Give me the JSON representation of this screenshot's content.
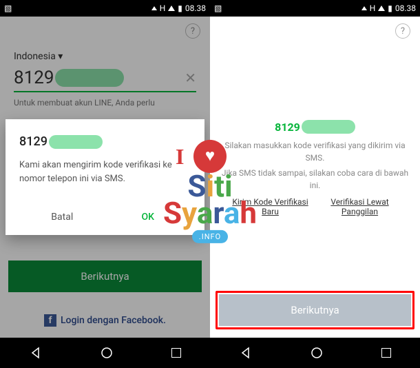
{
  "statusbar": {
    "time": "08.38",
    "net": "H"
  },
  "left": {
    "country": "Indonesia",
    "phone_prefix": "8129",
    "hint": "Untuk membuat akun LINE, Anda perlu",
    "primary": "Berikutnya",
    "fb": "Login dengan Facebook.",
    "dialog": {
      "phone_prefix": "8129",
      "msg": "Kami akan mengirim kode verifikasi ke nomor telepon ini via SMS.",
      "cancel": "Batal",
      "ok": "OK"
    }
  },
  "right": {
    "phone_prefix": "8129",
    "msg1": "Silakan masukkan kode verifikasi yang dikirim via SMS.",
    "msg2": "Jika SMS tidak sampai, silakan coba cara di bawah ini.",
    "link1": "Kirim Kode Verifikasi Baru",
    "link2": "Verifikasi Lewat Panggilan",
    "primary": "Berikutnya"
  },
  "watermark": {
    "info": ".INFO"
  }
}
